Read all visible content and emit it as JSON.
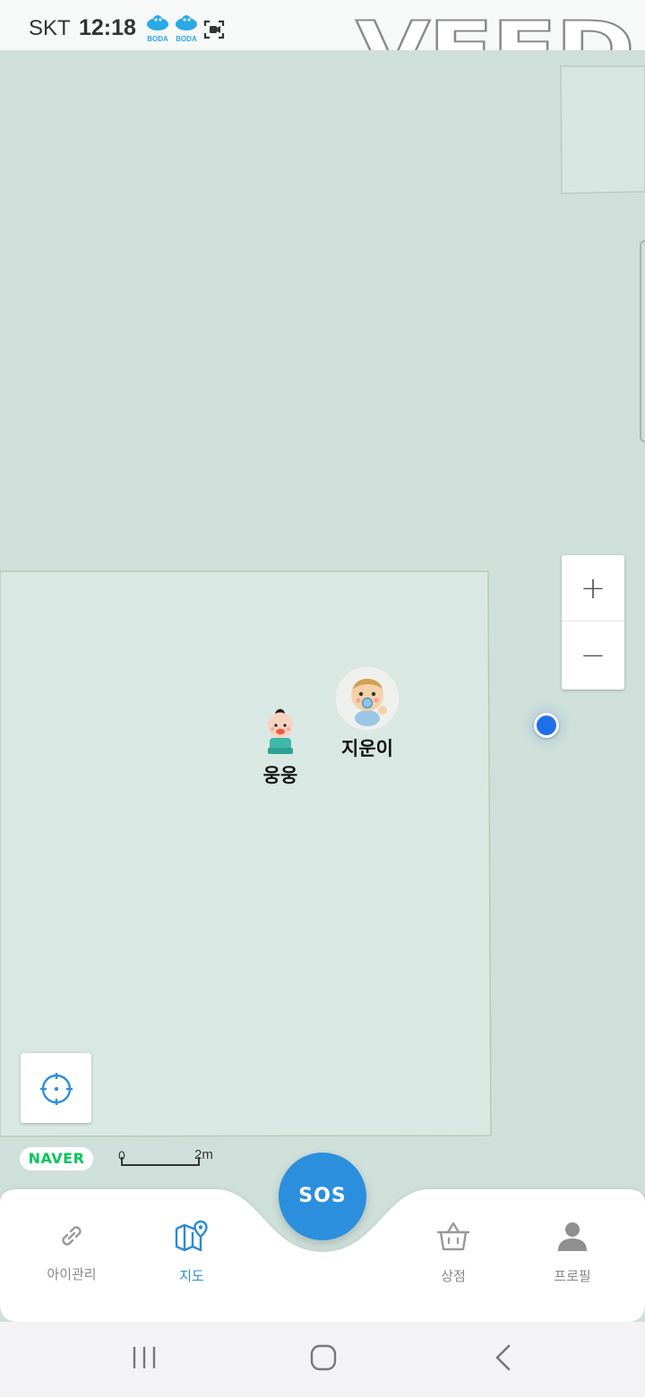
{
  "status_bar": {
    "carrier": "SKT",
    "time": "12:18",
    "notification_icons": [
      "boda-app-icon",
      "boda-app-icon",
      "screen-recorder-icon"
    ],
    "boda_icon_text": "BODA"
  },
  "watermark": {
    "text": "VEED"
  },
  "map": {
    "provider_logo": "NAVER",
    "zoom_in_label": "+",
    "zoom_out_label": "−",
    "scale": {
      "start": "0",
      "end": "2m"
    },
    "children": [
      {
        "name": "웅웅",
        "avatar": "baby-boy-icon"
      },
      {
        "name": "지운이",
        "avatar": "baby-photo-icon"
      }
    ],
    "my_location_color": "#1f6fe8",
    "background_color": "#cfe0da"
  },
  "bottom_nav": {
    "items": [
      {
        "label": "아이관리",
        "icon": "link-icon",
        "active": false
      },
      {
        "label": "지도",
        "icon": "map-pin-icon",
        "active": true
      },
      {
        "label": "상점",
        "icon": "basket-icon",
        "active": false
      },
      {
        "label": "프로필",
        "icon": "person-icon",
        "active": false
      }
    ],
    "sos_label": "SOS",
    "accent_color": "#2b8fde"
  },
  "system_nav": {
    "buttons": [
      "recents-icon",
      "home-icon",
      "back-icon"
    ]
  }
}
